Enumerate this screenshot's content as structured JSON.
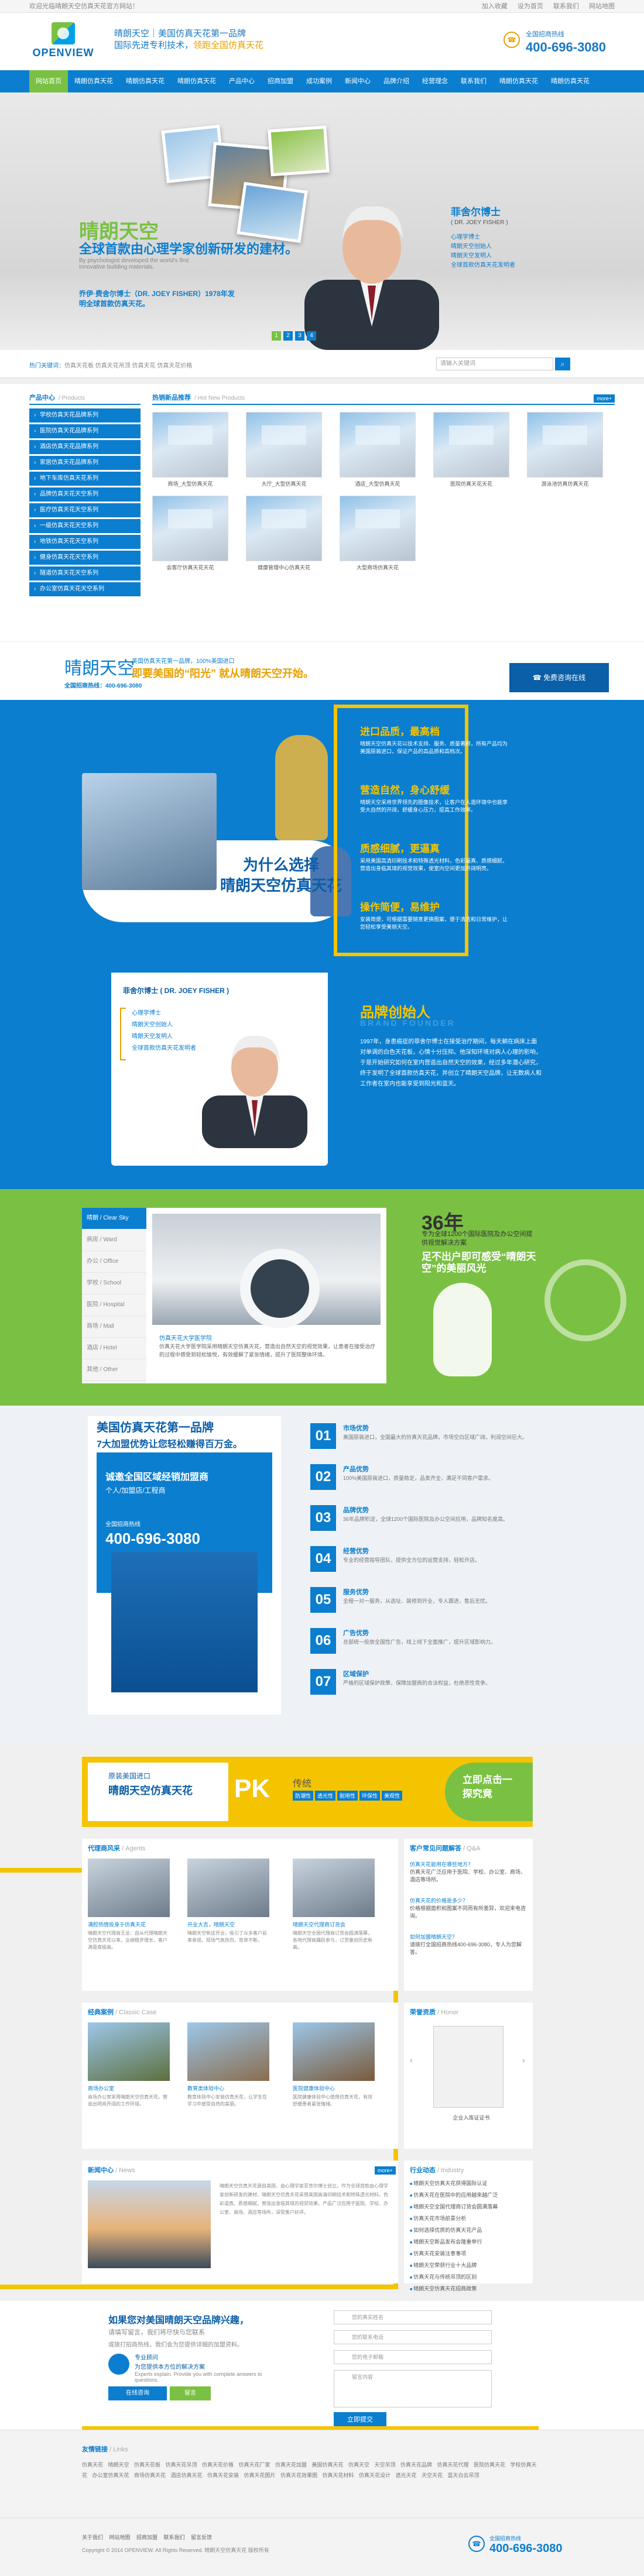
{
  "topbar": {
    "welcome": "欢迎光临晴朗天空仿真天花官方网站！",
    "links": [
      "加入收藏",
      "设为首页",
      "联系我们",
      "网站地图"
    ]
  },
  "header": {
    "logo_text": "OPENVIEW",
    "slogan1": "晴朗天空｜美国仿真天花第一品牌",
    "slogan2": "国际先进专利技术，",
    "slogan2b": "领跑全国仿真天花",
    "hotline_label": "全国招商热线",
    "hotline": "400-696-3080"
  },
  "nav": [
    "网站首页",
    "晴朗仿真天花",
    "晴朗仿真天花",
    "晴朗仿真天花",
    "产品中心",
    "招商加盟",
    "成功案例",
    "新闻中心",
    "品牌介绍",
    "经营理念",
    "联系我们",
    "晴朗仿真天花",
    "晴朗仿真天花"
  ],
  "banner": {
    "t1": "晴朗天空",
    "t2": "全球首款由心理学家创新研发的建材。",
    "t3": "By psychologist developed the world's first innovative building materials.",
    "t4": "乔伊·费舍尔博士（DR. JOEY FISHER）1978年发明全球首款仿真天花。",
    "name": "菲舍尔博士",
    "ename": "( DR. JOEY FISHER )",
    "desc": [
      "心理学博士",
      "晴朗天空创始人",
      "晴朗天空发明人",
      "全球首款仿真天花发明者"
    ],
    "pages": [
      "1",
      "2",
      "3",
      "4"
    ]
  },
  "search": {
    "hot_label": "热门关键词：",
    "hot": "仿真天花板   仿真天花吊顶   仿真天花   仿真天花价格",
    "placeholder": "请输入关键词",
    "btn": "⌕"
  },
  "products": {
    "cat_title": "产品中心",
    "cat_en": "/ Products",
    "cats": [
      "学校仿真天花品牌系列",
      "医院仿真天花品牌系列",
      "酒店仿真天花品牌系列",
      "家居仿真天花品牌系列",
      "地下车库仿真天花系列",
      "品牌仿真天花天空系列",
      "医疗仿真天花天空系列",
      "一级仿真天花天空系列",
      "地铁仿真天花天空系列",
      "健身仿真天花天空系列",
      "隧道仿真天花天空系列",
      "办公室仿真天花天空系列"
    ],
    "hot_title": "热销新品推荐",
    "hot_en": "/ Hot New Products",
    "more": "more+",
    "items": [
      "商场_大型仿真天花",
      "大厅_大型仿真天花",
      "酒店_大型仿真天花",
      "医院仿真天花天花",
      "游泳池仿真仿真天花",
      "会客厅仿真天花天花",
      "健康管理中心仿真天花",
      "大型商场仿真天花"
    ]
  },
  "ad": {
    "t1": "晴朗天空",
    "t1s": "美国仿真天花第一品牌，100%美国进口",
    "t2": "即要美国的“阳光” 就从晴朗天空开始。",
    "t3": "全国招商热线：400-696-3080",
    "btn": "免费咨询在线"
  },
  "why": {
    "t1": "为什么选择",
    "t2": "晴朗天空仿真天花",
    "t3": "WHY OPENVIEW",
    "features": [
      {
        "h": "进口品质，最高档",
        "p": "晴朗天空仿真天花以技术支持、服务、质量著称，所有产品均为美国原装进口，保证产品的高品质和高档次。"
      },
      {
        "h": "营造自然，身心舒缓",
        "p": "晴朗天空采用世界领先的图像技术，让客户在人造环境中也能享受大自然的开阔，舒缓身心压力，提高工作效率。"
      },
      {
        "h": "质感细腻，更逼真",
        "p": "采用美国高清印刷技术和特殊透光材料，色彩逼真、质感细腻，营造出身临其境的视觉效果，使室内空间更加开阔明亮。"
      },
      {
        "h": "操作简便，易维护",
        "p": "安装简便，可根据需要随意更换图案，便于清洁和日常维护，让您轻松享受美丽天空。"
      }
    ]
  },
  "founder": {
    "name": "菲舍尔博士 ( DR. JOEY FISHER )",
    "lines": [
      "心理学博士",
      "晴朗天空创始人",
      "晴朗天空发明人",
      "全球首款仿真天花发明者"
    ],
    "title": "品牌创始人",
    "sub": "BRAND FOUNDER",
    "text": "1997年，身患癌症的菲舍尔博士在接受治疗期间，每天躺在病床上面对单调的白色天花板，心情十分压抑。他深知环境对病人心理的影响，于是开始研究如何在室内营造出自然天空的效果，经过多年潜心研究，终于发明了全球首款仿真天花，并创立了晴朗天空品牌，让无数病人和工作者在室内也能享受到阳光和蓝天。"
  },
  "green": {
    "tabs": [
      "晴朗 / Clear Sky",
      "病房 / Ward",
      "办公 / Office",
      "学校 / School",
      "医院 / Hospital",
      "商场 / Mall",
      "酒店 / Hotel",
      "其他 / Other"
    ],
    "title": "仿真天花大学医学院",
    "desc": "仿真天花大学医学院采用晴朗天空仿真天花，营造出自然天空的视觉效果，让患者在接受治疗的过程中感受到轻松愉悦，有效缓解了紧张情绪，提升了医院整体环境。",
    "y36": "36年",
    "y36s": "专为全球1200个国际医院及办公空间提供视觉解决方案",
    "y36t": "足不出户即可感受“晴朗天空”的美丽风光"
  },
  "seven": {
    "t1": "美国仿真天花第一品牌",
    "t2": "7大加盟优势让您轻松赚得百万金。",
    "l1": "诚邀全国区域经销加盟商",
    "l1b": "个人/加盟店/工程商",
    "l2": "全国招商热线",
    "l3": "400-696-3080",
    "items": [
      {
        "n": "01",
        "h": "市场优势",
        "p": "美国原装进口，全国最大的仿真天花品牌，市场空白区域广阔，利润空间巨大。"
      },
      {
        "n": "02",
        "h": "产品优势",
        "p": "100%美国原装进口，质量稳定，品类齐全，满足不同客户需求。"
      },
      {
        "n": "03",
        "h": "品牌优势",
        "p": "36年品牌积淀，全球1200个国际医院及办公空间应用，品牌知名度高。"
      },
      {
        "n": "04",
        "h": "经营优势",
        "p": "专业的经营指导团队，提供全方位的运营支持，轻松开店。"
      },
      {
        "n": "05",
        "h": "服务优势",
        "p": "全程一对一服务，从选址、装修到开业，专人跟进，售后无忧。"
      },
      {
        "n": "06",
        "h": "广告优势",
        "p": "总部统一投放全国性广告，线上线下全面推广，提升区域影响力。"
      },
      {
        "n": "07",
        "h": "区域保护",
        "p": "严格的区域保护政策，保障加盟商的合法权益，杜绝恶性竞争。"
      }
    ]
  },
  "pk": {
    "l1": "原装美国进口",
    "l2": "晴朗天空仿真天花",
    "pk": "PK",
    "r1": "传统",
    "tags": [
      "防潮性",
      "透光性",
      "耐用性",
      "环保性",
      "美观性"
    ],
    "btn": "立即点击一探究竟"
  },
  "news": {
    "client_title": "代理商风采",
    "client_en": "/ Agents",
    "clients": [
      {
        "cap": "满腔热情投身于仿真天花",
        "d": "晴朗天空代理商王总：自从代理晴朗天空仿真天花以来，业绩稳步增长，客户满意度极高。"
      },
      {
        "cap": "开业大吉，晴朗天空",
        "d": "晴朗天空新店开业，吸引了众多客户前来参观，现场气氛热烈，签单不断。"
      },
      {
        "cap": "晴朗天空代理商订货会",
        "d": "晴朗天空全国代理商订货会圆满落幕，各地代理商踊跃参与，订货量创历史新高。"
      }
    ],
    "faq_title": "客户常见问题解答",
    "faq_en": "/ Q&A",
    "faqs": [
      {
        "q": "仿真天花能用在哪些地方？",
        "a": "仿真天花广泛应用于医院、学校、办公室、商场、酒店等场所。"
      },
      {
        "q": "仿真天花的价格是多少？",
        "a": "价格根据面积和图案不同而有所差异，欢迎来电咨询。"
      },
      {
        "q": "如何加盟晴朗天空？",
        "a": "请拨打全国招商热线400-696-3080，专人为您解答。"
      }
    ],
    "case_title": "经典案例",
    "case_en": "/ Classic Case",
    "cases": [
      {
        "cap": "商场办公室",
        "d": "商场办公室采用晴朗天空仿真天花，营造出明亮开阔的工作环境。"
      },
      {
        "cap": "教育类体验中心",
        "d": "教育体验中心安装仿真天花，让学生在学习中感受自然的美丽。"
      },
      {
        "cap": "医院健康体验中心",
        "d": "医院健康体验中心使用仿真天花，有效舒缓患者紧张情绪。"
      }
    ],
    "honor_title": "荣誉资质",
    "honor_en": "/ Honor",
    "honor_cap": "企业入库证证书",
    "news_title": "新闻中心",
    "news_en": "/ News",
    "news_text": "晴朗天空仿真天花源自美国，由心理学家菲舍尔博士创立。作为全球首款由心理学家创新研发的建材，晴朗天空仿真天花采用美国高清印刷技术和特殊透光材料，色彩逼真、质感细腻，营造出身临其境的视觉效果。产品广泛应用于医院、学校、办公室、商场、酒店等场所，深受客户好评。",
    "more": "more+",
    "list_title": "行业动态",
    "list_en": "/ Industry",
    "list": [
      "晴朗天空仿真天花获得国际认证",
      "仿真天花在医院中的应用越来越广泛",
      "晴朗天空全国代理商订货会圆满落幕",
      "仿真天花市场前景分析",
      "如何选择优质的仿真天花产品",
      "晴朗天空新品发布会隆重举行",
      "仿真天花安装注意事项",
      "晴朗天空荣获行业十大品牌",
      "仿真天花与传统吊顶的区别",
      "晴朗天空仿真天花招商政策"
    ]
  },
  "contact": {
    "t1": "如果您对美国晴朗天空品牌兴趣，",
    "t1b": "请填写留言，我们将尽快与您联系",
    "st": "或拨打招商热线，我们会为您提供详细的加盟资料。",
    "e1": "专业顾问",
    "e2": "为您提供本方位的解决方案",
    "e3": "Experts explain. Provide you with complete answers to questions.",
    "b1": "在线咨询",
    "b2": "留言",
    "fields": [
      "您的真实姓名",
      "您的联系电话",
      "您的电子邮箱",
      "留言内容"
    ],
    "submit": "立即提交"
  },
  "flinks": {
    "title": "友情链接",
    "title_en": "/ Links",
    "links": "仿真天花  晴朗天空  仿真天花板  仿真天花吊顶  仿真天花价格  仿真天花厂家  仿真天花加盟  美国仿真天花  仿真天空  天空吊顶  仿真天花品牌  仿真天花代理  医院仿真天花  学校仿真天花  办公室仿真天花  商场仿真天花  酒店仿真天花  仿真天花安装  仿真天花图片  仿真天花效果图  仿真天花材料  仿真天花设计  透光天花  天空天花  蓝天白云吊顶"
  },
  "footer": {
    "menu": "关于我们  网站地图  招商加盟  联系我们  留言反馈",
    "copy": "Copyright © 2014 OPENVIEW. All Rights Reserved.  晴朗天空仿真天花 版权所有",
    "hotline_label": "全国招商热线",
    "hotline": "400-696-3080"
  }
}
